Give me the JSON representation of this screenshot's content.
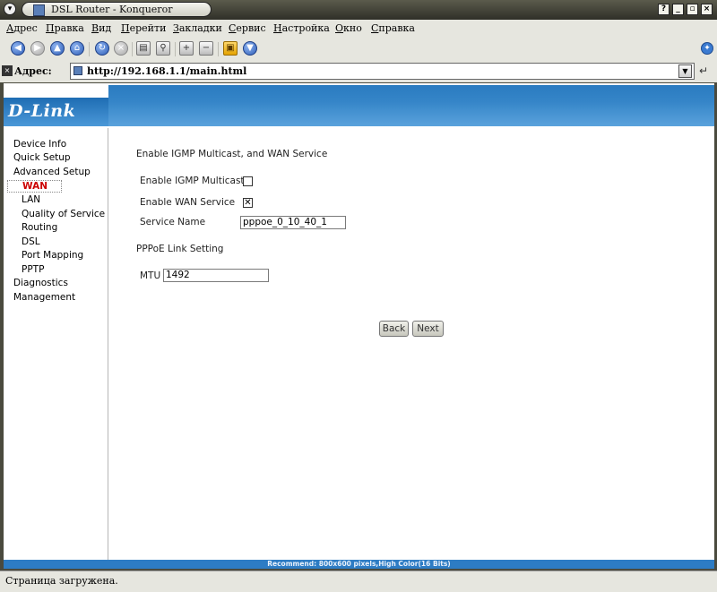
{
  "window": {
    "title": "DSL Router - Konqueror"
  },
  "menubar": [
    "Адрес",
    "Правка",
    "Вид",
    "Перейти",
    "Закладки",
    "Сервис",
    "Настройка",
    "Окно",
    "Справка"
  ],
  "address": {
    "label": "Адрес:",
    "url": "http://192.168.1.1/main.html"
  },
  "brand": {
    "logo": "D-Link"
  },
  "sidebar": {
    "items": [
      {
        "label": "Device Info"
      },
      {
        "label": "Quick Setup"
      },
      {
        "label": "Advanced Setup"
      },
      {
        "label": "WAN"
      },
      {
        "label": "LAN"
      },
      {
        "label": "Quality of Service"
      },
      {
        "label": "Routing"
      },
      {
        "label": "DSL"
      },
      {
        "label": "Port Mapping"
      },
      {
        "label": "PPTP"
      },
      {
        "label": "Diagnostics"
      },
      {
        "label": "Management"
      }
    ]
  },
  "main": {
    "heading": "Enable IGMP Multicast, and WAN Service",
    "igmp_label": "Enable IGMP Multicast",
    "igmp_checked": false,
    "wan_label": "Enable WAN Service",
    "wan_checked": true,
    "wan_mark": "✕",
    "service_name_label": "Service Name",
    "service_name_value": "pppoe_0_10_40_1",
    "pppoe_heading": "PPPoE Link Setting",
    "mtu_label": "MTU",
    "mtu_value": "1492",
    "back_label": "Back",
    "next_label": "Next"
  },
  "footer": {
    "text": "Recommend: 800x600 pixels,High Color(16 Bits)"
  },
  "status": {
    "text": "Страница загружена."
  }
}
